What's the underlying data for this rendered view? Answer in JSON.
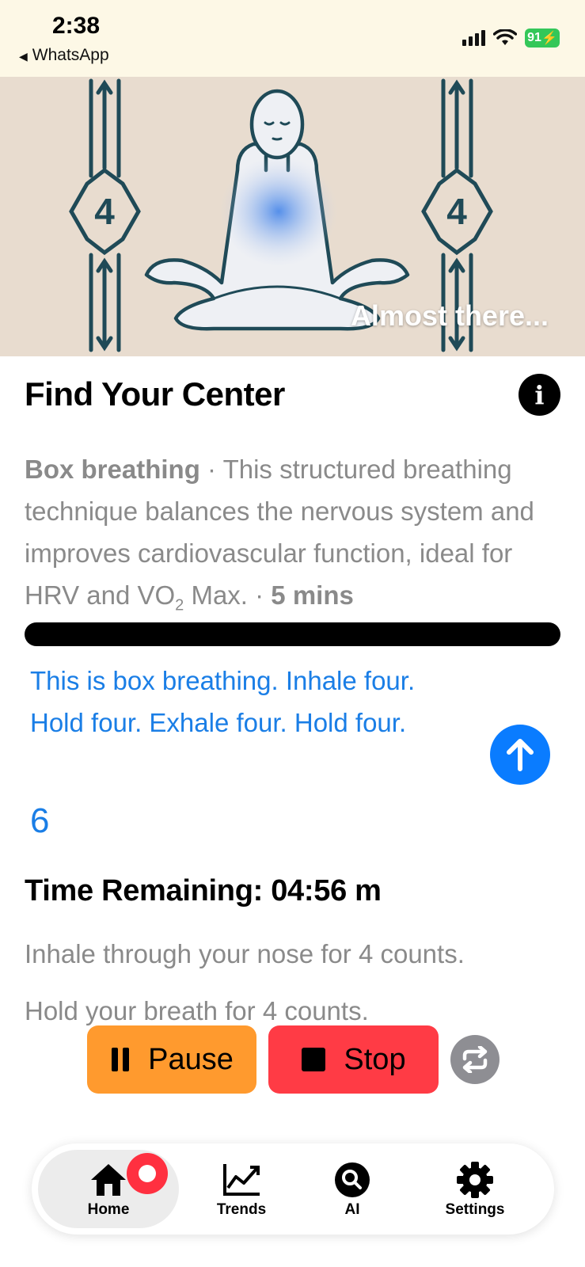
{
  "status_bar": {
    "time": "2:38",
    "back_label": "WhatsApp",
    "battery": "91"
  },
  "hero": {
    "caption": "Almost there...",
    "hold_count_left": "4",
    "hold_count_right": "4"
  },
  "session": {
    "title": "Find Your Center",
    "technique": "Box breathing",
    "separator": " · ",
    "description": "This structured breathing technique balances the nervous system and improves cardiovascular function, ideal for HRV and VO",
    "subscript": "2",
    "description_end": " Max.",
    "duration": "5 mins",
    "script_text": "This is box breathing. Inhale four. Hold four. Exhale four. Hold four.",
    "count": "6",
    "time_remaining": "Time Remaining: 04:56 m",
    "steps": [
      "Inhale through your nose for 4 counts.",
      "Hold your breath for 4 counts."
    ]
  },
  "controls": {
    "pause_label": "Pause",
    "stop_label": "Stop"
  },
  "tabbar": {
    "home": "Home",
    "trends": "Trends",
    "ai": "AI",
    "settings": "Settings"
  },
  "colors": {
    "accent_blue": "#0a7cff",
    "pause": "#ff9a2e",
    "stop": "#ff3b45",
    "status_bg": "#fdf8e6"
  }
}
